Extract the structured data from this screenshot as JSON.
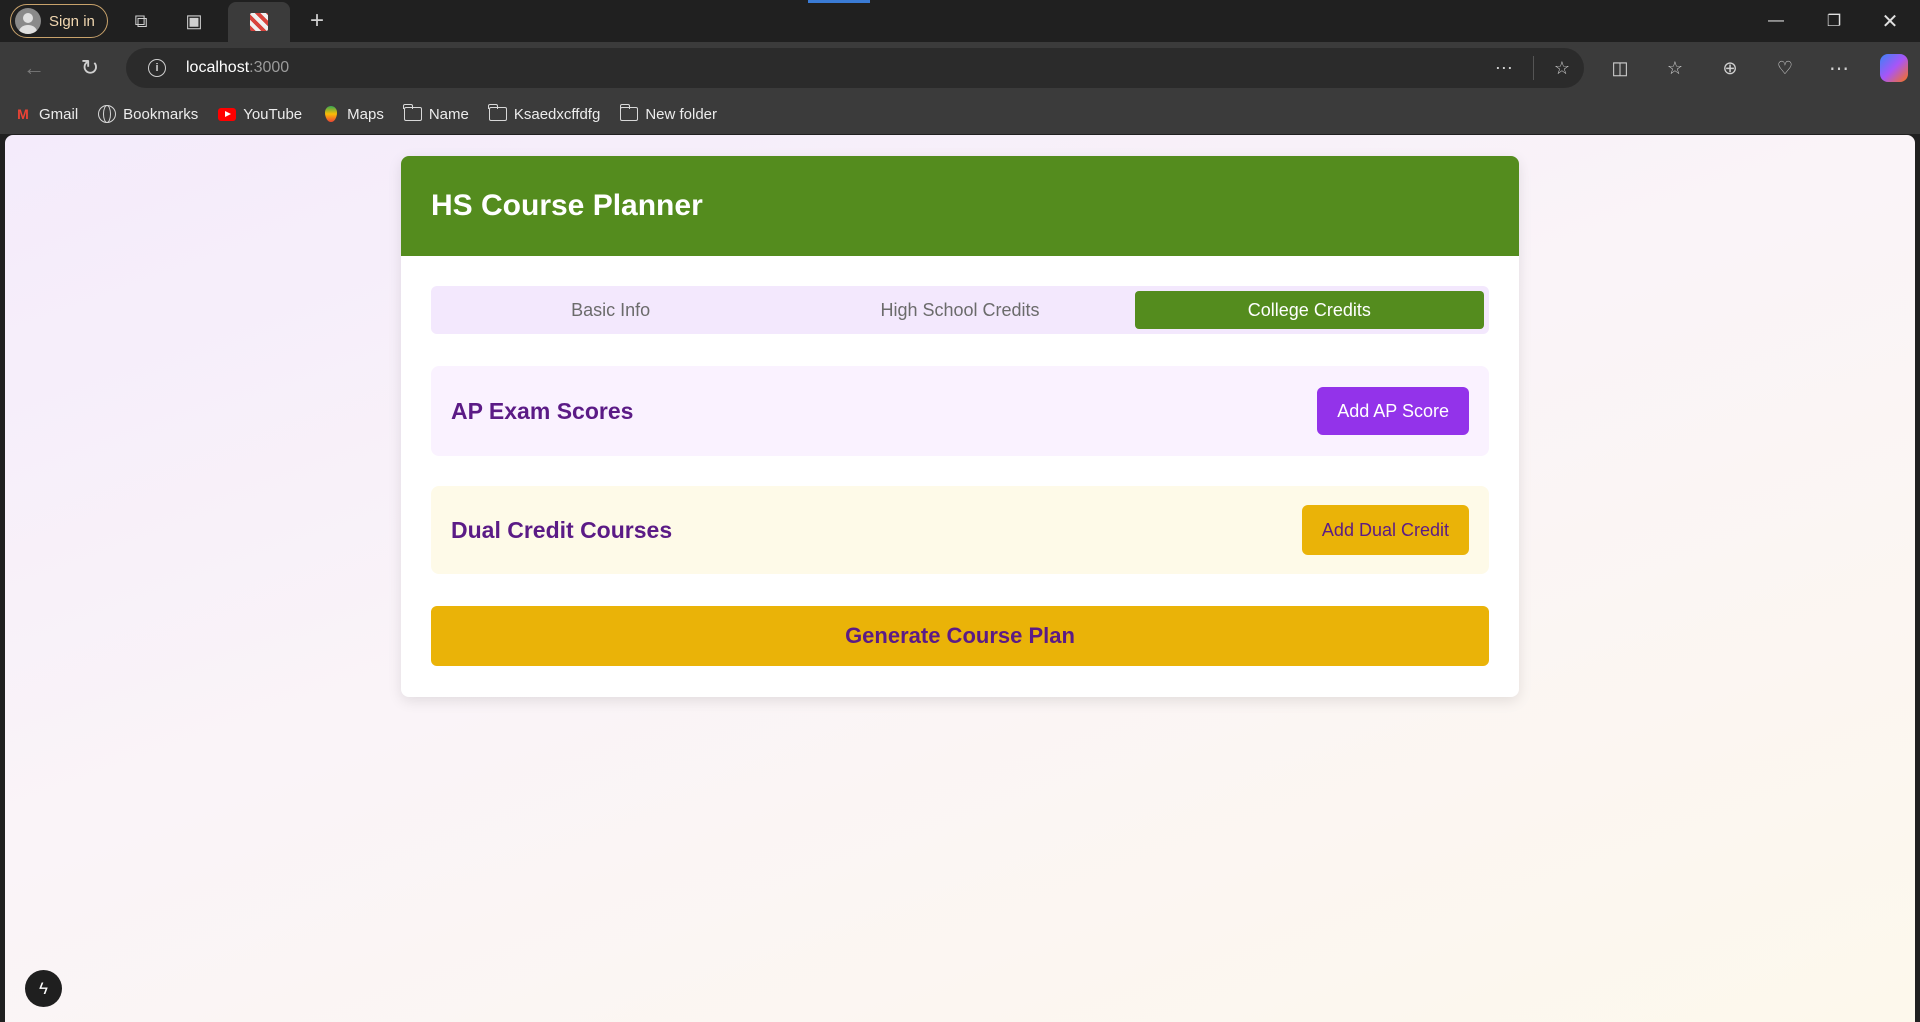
{
  "browser": {
    "signin_label": "Sign in",
    "address": {
      "host": "localhost",
      "port": ":3000"
    },
    "bookmarks": [
      {
        "label": "Gmail",
        "icon": "gmail-icon"
      },
      {
        "label": "Bookmarks",
        "icon": "globe-icon"
      },
      {
        "label": "YouTube",
        "icon": "youtube-icon"
      },
      {
        "label": "Maps",
        "icon": "maps-icon"
      },
      {
        "label": "Name",
        "icon": "folder-icon"
      },
      {
        "label": "Ksaedxcffdfg",
        "icon": "folder-icon"
      },
      {
        "label": "New folder",
        "icon": "folder-icon"
      }
    ]
  },
  "app": {
    "title": "HS Course Planner",
    "tabs": [
      {
        "label": "Basic Info",
        "active": false
      },
      {
        "label": "High School Credits",
        "active": false
      },
      {
        "label": "College Credits",
        "active": true
      }
    ],
    "ap_section": {
      "title": "AP Exam Scores",
      "button": "Add AP Score"
    },
    "dual_section": {
      "title": "Dual Credit Courses",
      "button": "Add Dual Credit"
    },
    "generate_button": "Generate Course Plan"
  },
  "colors": {
    "header_green": "#548c1e",
    "purple": "#9333ea",
    "gold": "#eab308",
    "text_purple": "#5b1b86"
  }
}
